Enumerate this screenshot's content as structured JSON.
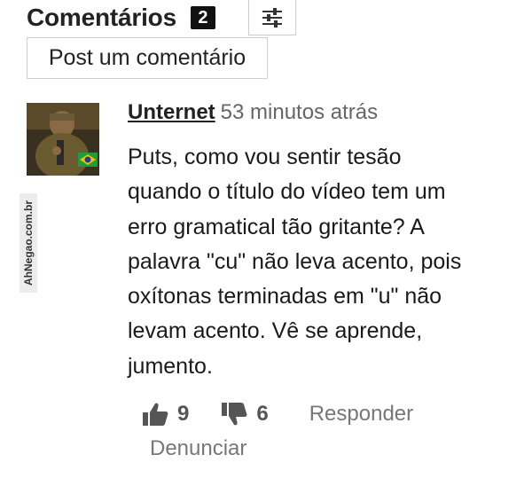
{
  "header": {
    "title": "Comentários",
    "count": "2",
    "filter_icon": "sliders-icon"
  },
  "post_button": {
    "label": "Post um comentário"
  },
  "comment": {
    "author": "Unternet",
    "time": "53 minutos atrás",
    "lines": [
      "Puts, como vou sentir tesão",
      "quando o título do vídeo tem um",
      "erro gramatical tão gritante? A",
      "palavra \"cu\" não leva acento, pois",
      "oxítonas terminadas em \"u\" não",
      "levam acento. Vê se aprende,",
      "jumento."
    ],
    "likes": "9",
    "dislikes": "6",
    "reply_label": "Responder",
    "report_label": "Denunciar"
  },
  "watermark": {
    "text": "AhNegao.com.br"
  },
  "colors": {
    "text": "#1a1a1a",
    "muted": "#777777",
    "badge": "#111111"
  }
}
